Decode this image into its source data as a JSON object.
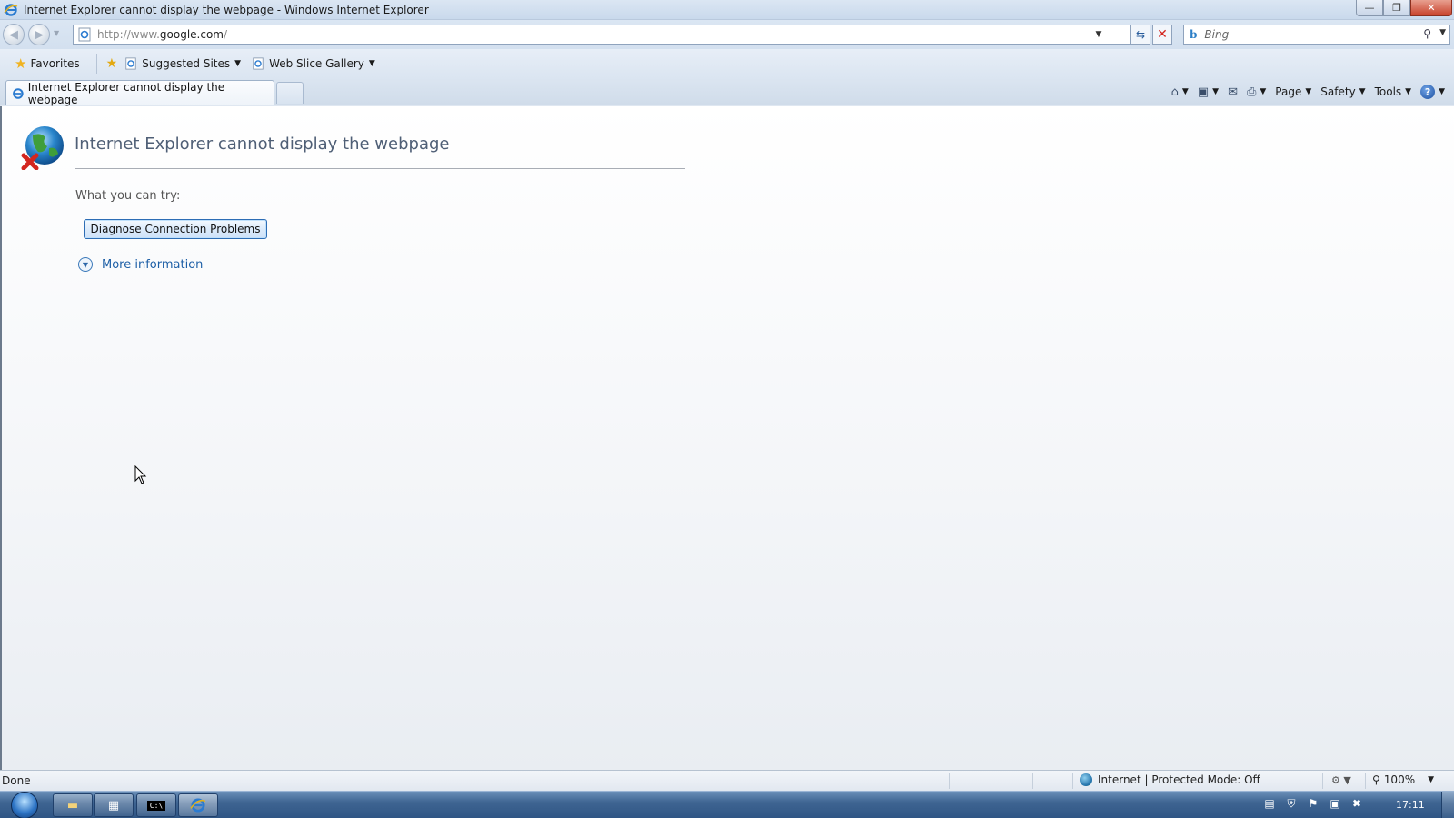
{
  "window": {
    "title": "Internet Explorer cannot display the webpage - Windows Internet Explorer",
    "controls": {
      "minimize": "—",
      "restore": "❐",
      "close": "✕"
    }
  },
  "address_bar": {
    "url_prefix": "http://www.",
    "url_domain": "google.com",
    "url_suffix": "/",
    "search_placeholder": "Bing",
    "search_provider_icon": "b"
  },
  "favorites_bar": {
    "favorites_label": "Favorites",
    "items": [
      {
        "label": "Suggested Sites"
      },
      {
        "label": "Web Slice Gallery"
      }
    ]
  },
  "tabs": {
    "active_tab_label": "Internet Explorer cannot display the webpage"
  },
  "command_bar": {
    "page_label": "Page",
    "safety_label": "Safety",
    "tools_label": "Tools",
    "help_glyph": "?"
  },
  "error_page": {
    "title": "Internet Explorer cannot display the webpage",
    "try_label": "What you can try:",
    "diagnose_button": "Diagnose Connection Problems",
    "more_info_label": "More information"
  },
  "status_bar": {
    "status": "Done",
    "zone": "Internet | Protected Mode: Off",
    "zoom": "100%"
  },
  "taskbar": {
    "clock": "17:11",
    "apps": [
      "windows-explorer",
      "task-manager",
      "command-prompt",
      "internet-explorer"
    ]
  },
  "colors": {
    "title_text": "#4f5f76",
    "link": "#1d5fa6",
    "error_x": "#d3261f",
    "taskbar": "#2f5584"
  }
}
